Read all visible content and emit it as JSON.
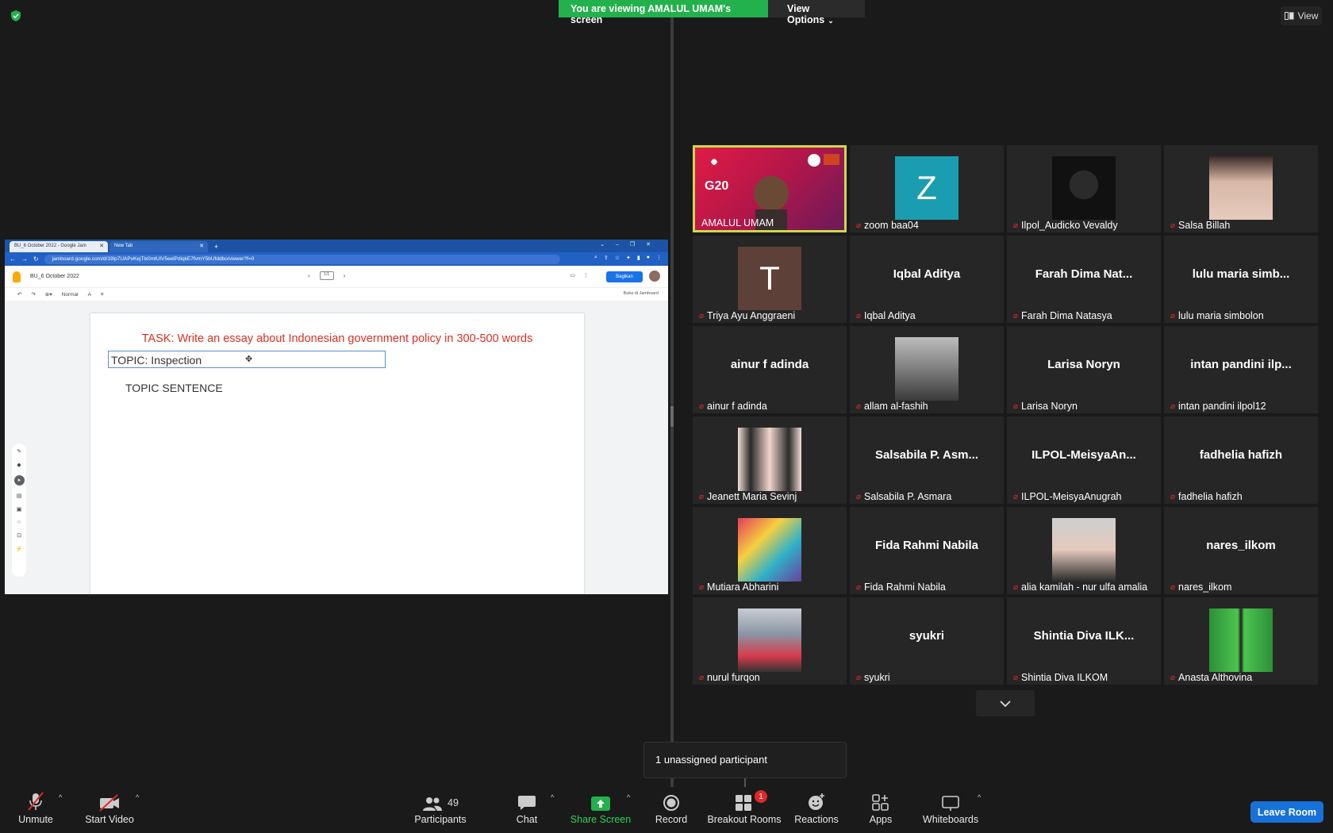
{
  "banner": {
    "viewing_text": "You are viewing AMALUL UMAM's screen",
    "view_options": "View Options"
  },
  "top_right": {
    "view_label": "View"
  },
  "shared": {
    "tab1": "BU_6 October 2022 - Google Jam",
    "tab2": "New Tab",
    "url": "jamboard.google.com/d/19lp7UAPvKejTlx0mtUlV5eelPdiqkE7fvmY5bUfddbo/viewer?f=0",
    "jam_title": "BU_6 October 2022",
    "page": "1/1",
    "share_button": "Bagikan",
    "zoom_select": "Normal",
    "open_in": "Buka di Jamboard",
    "task": "TASK: Write an essay about Indonesian government policy in 300-500 words",
    "topic": "TOPIC: Inspection",
    "topic_sentence": "TOPIC SENTENCE"
  },
  "participants": [
    {
      "name": "AMALUL UMAM",
      "type": "video-g20",
      "muted": false,
      "active": true
    },
    {
      "name": "zoom baa04",
      "type": "initial",
      "initial": "Z",
      "bg": "#1a9db0",
      "muted": true
    },
    {
      "name": "Ilpol_Audicko Vevaldy",
      "type": "photo",
      "muted": true
    },
    {
      "name": "Salsa Billah",
      "type": "photo",
      "muted": true
    },
    {
      "name": "Triya Ayu Anggraeni",
      "type": "initial",
      "initial": "T",
      "bg": "#5d4037",
      "muted": true
    },
    {
      "name": "Iqbal Aditya",
      "type": "text",
      "big": "Iqbal Aditya",
      "muted": true
    },
    {
      "name": "Farah Dima Natasya",
      "type": "text",
      "big": "Farah Dima Nat...",
      "muted": true
    },
    {
      "name": "lulu maria simbolon",
      "type": "text",
      "big": "lulu maria simb...",
      "muted": true
    },
    {
      "name": "ainur f adinda",
      "type": "text",
      "big": "ainur f adinda",
      "muted": true
    },
    {
      "name": "allam al-fashih",
      "type": "photo",
      "muted": true
    },
    {
      "name": "Larisa Noryn",
      "type": "text",
      "big": "Larisa Noryn",
      "muted": true
    },
    {
      "name": "intan pandini ilpol12",
      "type": "text",
      "big": "intan pandini ilp...",
      "muted": true
    },
    {
      "name": "Jeanett Maria Sevinj",
      "type": "photo",
      "muted": true
    },
    {
      "name": "Salsabila P. Asmara",
      "type": "text",
      "big": "Salsabila P. Asm...",
      "muted": true
    },
    {
      "name": "ILPOL-MeisyaAnugrah",
      "type": "text",
      "big": "ILPOL-MeisyaAn...",
      "muted": true
    },
    {
      "name": "fadhelia hafizh",
      "type": "text",
      "big": "fadhelia hafizh",
      "muted": true
    },
    {
      "name": "Mutiara Abharini",
      "type": "photo",
      "muted": true
    },
    {
      "name": "Fida Rahmi Nabila",
      "type": "text",
      "big": "Fida Rahmi Nabila",
      "muted": true
    },
    {
      "name": "alia kamilah - nur ulfa amalia",
      "type": "photo",
      "muted": true
    },
    {
      "name": "nares_ilkom",
      "type": "text",
      "big": "nares_ilkom",
      "muted": true
    },
    {
      "name": "nurul furqon",
      "type": "photo",
      "muted": true
    },
    {
      "name": "syukri",
      "type": "text",
      "big": "syukri",
      "muted": true
    },
    {
      "name": "Shintia Diva ILKOM",
      "type": "text",
      "big": "Shintia Diva ILK...",
      "muted": true
    },
    {
      "name": "Anasta Althovina",
      "type": "photo",
      "muted": true
    }
  ],
  "toast": "1 unassigned participant",
  "toolbar": {
    "unmute": "Unmute",
    "start_video": "Start Video",
    "participants": "Participants",
    "participants_count": "49",
    "chat": "Chat",
    "share_screen": "Share Screen",
    "record": "Record",
    "breakout": "Breakout Rooms",
    "breakout_badge": "1",
    "reactions": "Reactions",
    "apps": "Apps",
    "whiteboards": "Whiteboards",
    "leave": "Leave Room"
  },
  "colors": {
    "banner_green": "#23b14d",
    "leave_blue": "#1671d9",
    "active_speaker": "#cdd84a",
    "muted_red": "#e02828"
  }
}
